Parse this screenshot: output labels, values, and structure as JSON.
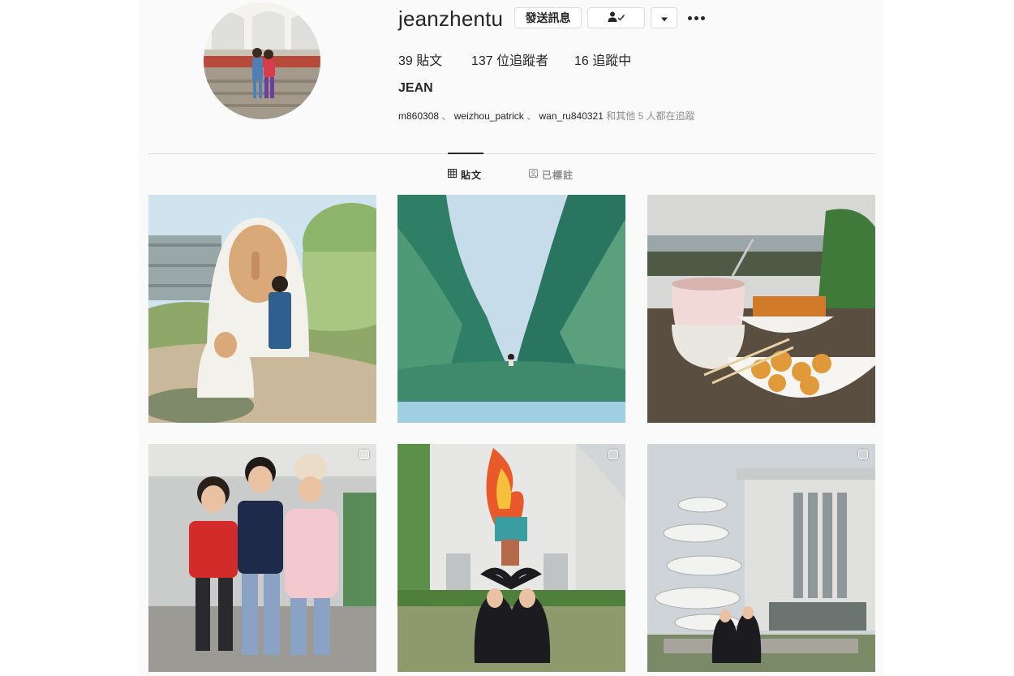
{
  "profile": {
    "username": "jeanzhentu",
    "full_name": "JEAN",
    "message_label": "發送訊息",
    "stats": {
      "posts_count": "39",
      "posts_label": "貼文",
      "followers_count": "137",
      "followers_label": "位追蹤者",
      "following_count": "16",
      "following_label": "追蹤中"
    },
    "followed_by": {
      "users": [
        "m860308",
        "weizhou_patrick",
        "wan_ru840321"
      ],
      "separator": "、",
      "suffix": "和其他 5 人都在追蹤"
    }
  },
  "tabs": {
    "posts_label": "貼文",
    "tagged_label": "已標註"
  },
  "icons": {
    "follow_state": "person-check-icon",
    "dropdown": "caret-down-icon",
    "more": "ellipsis-icon",
    "posts_tab": "grid-icon",
    "tagged_tab": "tag-person-icon",
    "multi_photo": "carousel-icon"
  },
  "colors": {
    "text_primary": "#262626",
    "text_secondary": "#8e8e8e",
    "border": "#dbdbdb",
    "background": "#fafafa"
  },
  "posts": [
    {
      "scene": "white hooded statues with girl on campus",
      "multi": false
    },
    {
      "scene": "girl sitting in green rocky gorge by the sea",
      "multi": false
    },
    {
      "scene": "pink mug and fried snacks by the sea",
      "multi": false
    },
    {
      "scene": "three friends posing indoors",
      "multi": true
    },
    {
      "scene": "graduates forming heart under mural",
      "multi": true
    },
    {
      "scene": "graduates by spiral sculpture and building",
      "multi": true
    }
  ]
}
